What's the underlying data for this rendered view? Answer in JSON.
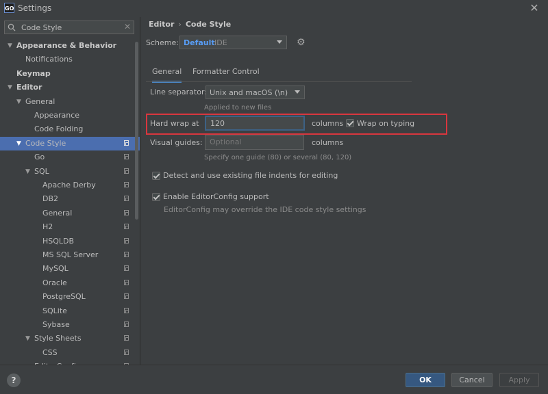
{
  "window": {
    "title": "Settings",
    "app_icon": "GO"
  },
  "search": {
    "value": "Code Style"
  },
  "tree": [
    {
      "label": "Appearance & Behavior",
      "level": 0,
      "expanded": true,
      "bold": true
    },
    {
      "label": "Notifications",
      "level": 1
    },
    {
      "label": "Keymap",
      "level": 0,
      "bold": true
    },
    {
      "label": "Editor",
      "level": 0,
      "expanded": true,
      "bold": true
    },
    {
      "label": "General",
      "level": 1,
      "expanded": true
    },
    {
      "label": "Appearance",
      "level": 2
    },
    {
      "label": "Code Folding",
      "level": 2
    },
    {
      "label": "Code Style",
      "level": 1,
      "expanded": true,
      "selected": true,
      "copy": true
    },
    {
      "label": "Go",
      "level": 2,
      "copy": true
    },
    {
      "label": "SQL",
      "level": 2,
      "expanded": true,
      "copy": true
    },
    {
      "label": "Apache Derby",
      "level": 3,
      "copy": true
    },
    {
      "label": "DB2",
      "level": 3,
      "copy": true
    },
    {
      "label": "General",
      "level": 3,
      "copy": true
    },
    {
      "label": "H2",
      "level": 3,
      "copy": true
    },
    {
      "label": "HSQLDB",
      "level": 3,
      "copy": true
    },
    {
      "label": "MS SQL Server",
      "level": 3,
      "copy": true
    },
    {
      "label": "MySQL",
      "level": 3,
      "copy": true
    },
    {
      "label": "Oracle",
      "level": 3,
      "copy": true
    },
    {
      "label": "PostgreSQL",
      "level": 3,
      "copy": true
    },
    {
      "label": "SQLite",
      "level": 3,
      "copy": true
    },
    {
      "label": "Sybase",
      "level": 3,
      "copy": true
    },
    {
      "label": "Style Sheets",
      "level": 2,
      "expanded": true,
      "copy": true
    },
    {
      "label": "CSS",
      "level": 3,
      "copy": true
    },
    {
      "label": "EditorConfig",
      "level": 2,
      "copy": true
    }
  ],
  "breadcrumb": {
    "parent": "Editor",
    "current": "Code Style"
  },
  "scheme": {
    "label": "Scheme:",
    "value": "Default",
    "sub": "IDE"
  },
  "tabs": [
    {
      "label": "General",
      "active": true
    },
    {
      "label": "Formatter Control"
    }
  ],
  "form": {
    "line_separator_label": "Line separator:",
    "line_separator_value": "Unix and macOS (\\n)",
    "line_separator_hint": "Applied to new files",
    "hard_wrap_label": "Hard wrap at",
    "hard_wrap_value": "120",
    "hard_wrap_unit": "columns",
    "wrap_on_typing_label": "Wrap on typing",
    "visual_guides_label": "Visual guides:",
    "visual_guides_placeholder": "Optional",
    "visual_guides_unit": "columns",
    "visual_guides_hint": "Specify one guide (80) or several (80, 120)",
    "detect_indents_label": "Detect and use existing file indents for editing",
    "editorconfig_label": "Enable EditorConfig support",
    "editorconfig_hint": "EditorConfig may override the IDE code style settings"
  },
  "footer": {
    "help": "?",
    "ok": "OK",
    "cancel": "Cancel",
    "apply": "Apply"
  }
}
